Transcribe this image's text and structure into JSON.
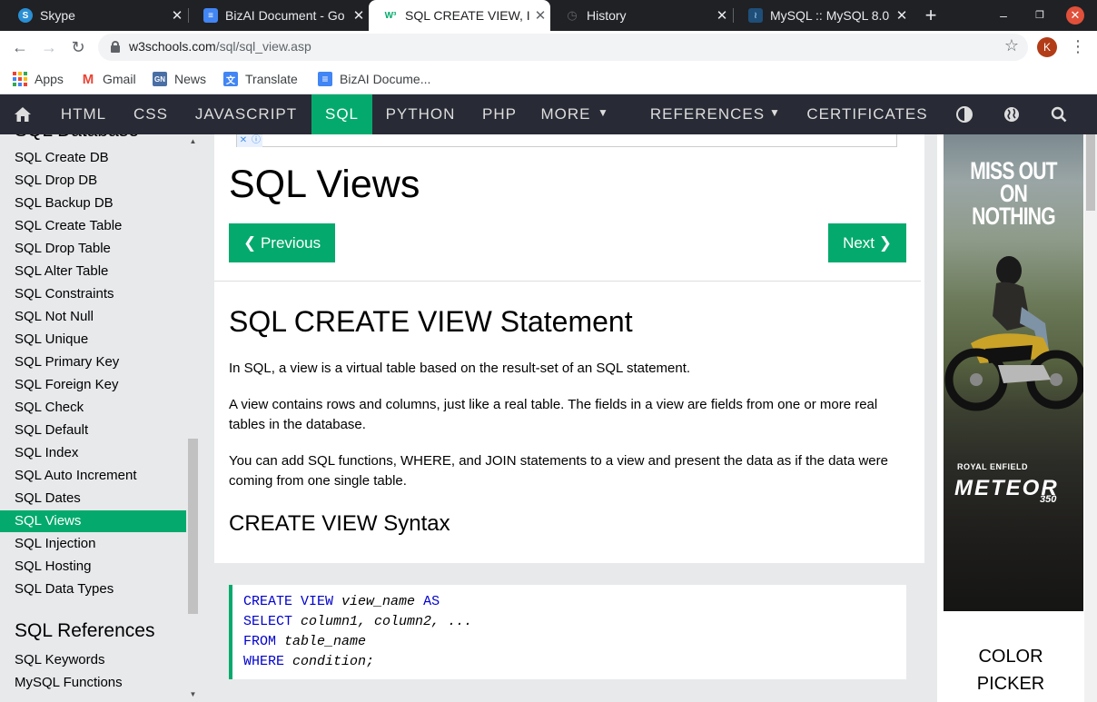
{
  "browser": {
    "tabs": [
      {
        "title": "Skype",
        "favicon": "skype-icon",
        "active": false
      },
      {
        "title": "BizAI Document - Go",
        "favicon": "google-docs-icon",
        "active": false
      },
      {
        "title": "SQL CREATE VIEW, I",
        "favicon": "w3schools-icon",
        "active": true
      },
      {
        "title": "History",
        "favicon": "history-icon",
        "active": false
      },
      {
        "title": "MySQL :: MySQL 8.0",
        "favicon": "mysql-icon",
        "active": false
      }
    ],
    "new_tab_glyph": "+",
    "url_host": "w3schools.com",
    "url_path": "/sql/sql_view.asp",
    "profile_initial": "K",
    "bookmarks": [
      "Apps",
      "Gmail",
      "News",
      "Translate",
      "BizAI Docume..."
    ]
  },
  "topnav": {
    "items": [
      "HTML",
      "CSS",
      "JAVASCRIPT",
      "SQL",
      "PYTHON",
      "PHP",
      "MORE",
      "REFERENCES",
      "CERTIFICATES"
    ],
    "active": "SQL",
    "accent": "#04aa6d",
    "background": "#282a35"
  },
  "sidebar": {
    "partial_heading": "SQL Database",
    "items": [
      "SQL Create DB",
      "SQL Drop DB",
      "SQL Backup DB",
      "SQL Create Table",
      "SQL Drop Table",
      "SQL Alter Table",
      "SQL Constraints",
      "SQL Not Null",
      "SQL Unique",
      "SQL Primary Key",
      "SQL Foreign Key",
      "SQL Check",
      "SQL Default",
      "SQL Index",
      "SQL Auto Increment",
      "SQL Dates",
      "SQL Views",
      "SQL Injection",
      "SQL Hosting",
      "SQL Data Types"
    ],
    "active": "SQL Views",
    "references_heading": "SQL References",
    "references": [
      "SQL Keywords",
      "MySQL Functions"
    ]
  },
  "main": {
    "title": "SQL Views",
    "prev_label": "❮ Previous",
    "next_label": "Next ❯",
    "h2": "SQL CREATE VIEW Statement",
    "p1": "In SQL, a view is a virtual table based on the result-set of an SQL statement.",
    "p2": "A view contains rows and columns, just like a real table. The fields in a view are fields from one or more real tables in the database.",
    "p3": "You can add SQL functions, WHERE, and JOIN statements to a view and present the data as if the data were coming from one single table.",
    "h3": "CREATE VIEW Syntax",
    "code": [
      {
        "kw": "CREATE VIEW",
        "rest": "view_name",
        "tail": "AS"
      },
      {
        "kw": "SELECT",
        "rest": "column1, column2, ...",
        "tail": ""
      },
      {
        "kw": "FROM",
        "rest": "table_name",
        "tail": ""
      },
      {
        "kw": "WHERE",
        "rest": "condition;",
        "tail": ""
      }
    ]
  },
  "ad": {
    "headline_1": "MISS OUT",
    "headline_2": "ON NOTHING",
    "brand": "ROYAL ENFIELD",
    "model": "METEOR",
    "model_number": "350"
  },
  "color_picker": {
    "line1": "COLOR",
    "line2": "PICKER"
  }
}
